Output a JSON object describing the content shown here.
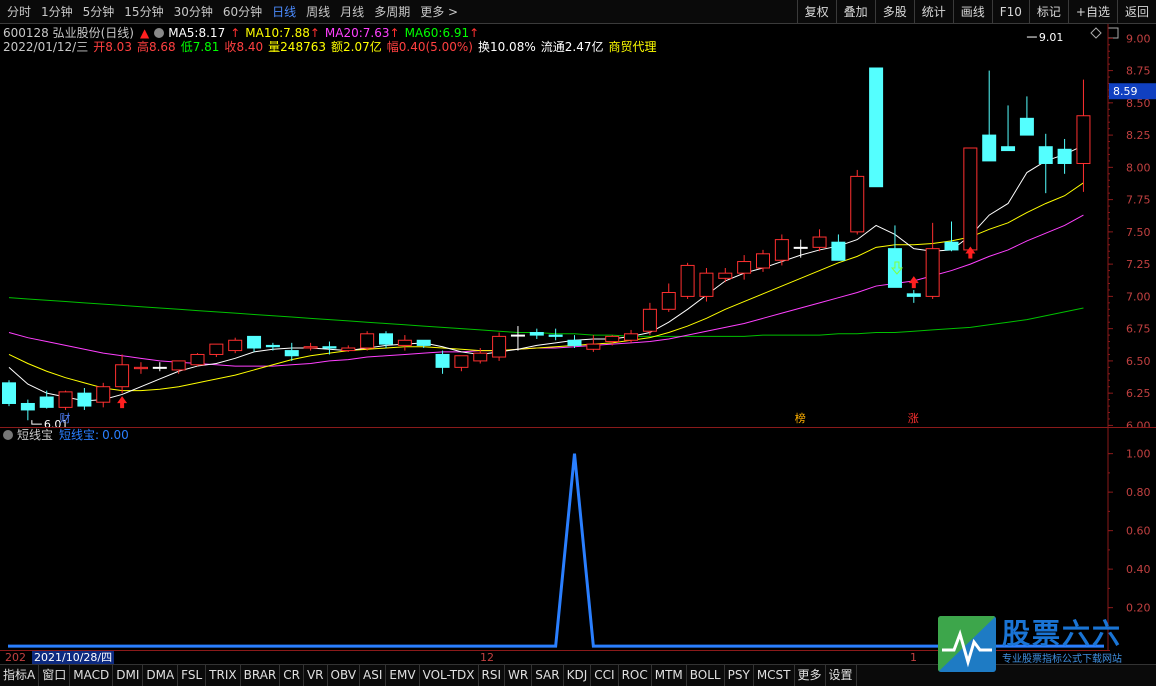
{
  "toolbar": {
    "tabs": [
      {
        "label": "分时"
      },
      {
        "label": "1分钟"
      },
      {
        "label": "5分钟"
      },
      {
        "label": "15分钟"
      },
      {
        "label": "30分钟"
      },
      {
        "label": "60分钟"
      },
      {
        "label": "日线",
        "active": true
      },
      {
        "label": "周线"
      },
      {
        "label": "月线"
      },
      {
        "label": "多周期"
      },
      {
        "label": "更多 >"
      }
    ],
    "right": [
      "复权",
      "叠加",
      "多股",
      "统计",
      "画线",
      "F10",
      "标记",
      "+自选",
      "返回"
    ]
  },
  "quote": {
    "stock": "600128 弘业股份(日线)",
    "ma5_label": "MA5:",
    "ma5": "8.17",
    "ma10_label": "MA10:",
    "ma10": "7.88",
    "ma20_label": "MA20:",
    "ma20": "7.63",
    "ma60_label": "MA60:",
    "ma60": "6.91",
    "date": "2022/01/12/三",
    "open_label": "开",
    "open": "8.03",
    "high_label": "高",
    "high": "8.68",
    "low_label": "低",
    "low": "7.81",
    "close_label": "收",
    "close": "8.40",
    "vol_label": "量",
    "vol": "248763",
    "amt_label": "额",
    "amt": "2.07亿",
    "chg_label": "幅",
    "chg": "0.40(5.00%)",
    "turn_label": "换",
    "turn": "10.08%",
    "float_label": "流通",
    "float": "2.47亿",
    "sector": "商贸代理"
  },
  "chart_data": [
    {
      "type": "candlestick",
      "y_ticks": [
        "9.00",
        "8.75",
        "8.50",
        "8.25",
        "8.00",
        "7.75",
        "7.50",
        "7.25",
        "7.00",
        "6.75",
        "6.50",
        "6.25",
        "6.00"
      ],
      "ylim": [
        5.98,
        9.08
      ],
      "current_price_label": "8.59",
      "high_annotation": "9.01",
      "low_annotation": "6.01",
      "event_markers": [
        "财",
        "榜",
        "涨"
      ],
      "ohlc": [
        [
          6.33,
          6.35,
          6.15,
          6.17
        ],
        [
          6.17,
          6.2,
          6.04,
          6.12
        ],
        [
          6.22,
          6.27,
          6.13,
          6.14
        ],
        [
          6.14,
          6.27,
          6.12,
          6.26
        ],
        [
          6.25,
          6.29,
          6.12,
          6.15
        ],
        [
          6.18,
          6.33,
          6.14,
          6.3
        ],
        [
          6.3,
          6.55,
          6.25,
          6.47
        ],
        [
          6.44,
          6.49,
          6.4,
          6.45
        ],
        [
          6.45,
          6.49,
          6.42,
          6.45
        ],
        [
          6.43,
          6.48,
          6.4,
          6.5
        ],
        [
          6.47,
          6.56,
          6.46,
          6.55
        ],
        [
          6.55,
          6.58,
          6.53,
          6.63
        ],
        [
          6.58,
          6.68,
          6.56,
          6.66
        ],
        [
          6.69,
          6.69,
          6.57,
          6.6
        ],
        [
          6.62,
          6.64,
          6.58,
          6.61
        ],
        [
          6.58,
          6.64,
          6.5,
          6.54
        ],
        [
          6.6,
          6.64,
          6.58,
          6.61
        ],
        [
          6.61,
          6.65,
          6.55,
          6.6
        ],
        [
          6.58,
          6.62,
          6.57,
          6.6
        ],
        [
          6.6,
          6.73,
          6.58,
          6.71
        ],
        [
          6.71,
          6.73,
          6.6,
          6.63
        ],
        [
          6.62,
          6.7,
          6.58,
          6.66
        ],
        [
          6.66,
          6.66,
          6.6,
          6.62
        ],
        [
          6.55,
          6.58,
          6.4,
          6.45
        ],
        [
          6.45,
          6.54,
          6.42,
          6.54
        ],
        [
          6.5,
          6.6,
          6.48,
          6.56
        ],
        [
          6.53,
          6.72,
          6.5,
          6.69
        ],
        [
          6.7,
          6.77,
          6.58,
          6.7
        ],
        [
          6.72,
          6.75,
          6.67,
          6.7
        ],
        [
          6.7,
          6.75,
          6.66,
          6.69
        ],
        [
          6.66,
          6.7,
          6.6,
          6.62
        ],
        [
          6.59,
          6.7,
          6.57,
          6.63
        ],
        [
          6.65,
          6.7,
          6.62,
          6.69
        ],
        [
          6.66,
          6.74,
          6.64,
          6.71
        ],
        [
          6.73,
          6.95,
          6.7,
          6.9
        ],
        [
          6.9,
          7.1,
          6.88,
          7.03
        ],
        [
          7.0,
          7.26,
          6.98,
          7.24
        ],
        [
          7.0,
          7.22,
          6.96,
          7.18
        ],
        [
          7.14,
          7.22,
          7.11,
          7.18
        ],
        [
          7.18,
          7.32,
          7.13,
          7.27
        ],
        [
          7.22,
          7.36,
          7.19,
          7.33
        ],
        [
          7.28,
          7.48,
          7.24,
          7.44
        ],
        [
          7.38,
          7.44,
          7.3,
          7.38
        ],
        [
          7.38,
          7.52,
          7.35,
          7.46
        ],
        [
          7.42,
          7.48,
          7.28,
          7.28
        ],
        [
          7.5,
          7.98,
          7.48,
          7.93
        ],
        [
          8.77,
          8.77,
          7.85,
          7.85
        ],
        [
          7.37,
          7.55,
          7.07,
          7.07
        ],
        [
          7.02,
          7.05,
          6.95,
          7.0
        ],
        [
          7.0,
          7.57,
          6.98,
          7.37
        ],
        [
          7.42,
          7.58,
          7.35,
          7.36
        ],
        [
          7.36,
          8.15,
          7.38,
          8.15
        ],
        [
          8.25,
          8.75,
          8.05,
          8.05
        ],
        [
          8.16,
          8.48,
          8.13,
          8.13
        ],
        [
          8.38,
          8.55,
          8.25,
          8.25
        ],
        [
          8.16,
          8.26,
          7.8,
          8.03
        ],
        [
          8.14,
          8.22,
          7.95,
          8.03
        ],
        [
          8.03,
          8.68,
          7.81,
          8.4
        ]
      ],
      "ma5": [
        6.45,
        6.32,
        6.25,
        6.22,
        6.19,
        6.2,
        6.24,
        6.3,
        6.36,
        6.42,
        6.46,
        6.48,
        6.52,
        6.57,
        6.59,
        6.6,
        6.6,
        6.59,
        6.58,
        6.6,
        6.62,
        6.63,
        6.64,
        6.61,
        6.57,
        6.55,
        6.57,
        6.59,
        6.62,
        6.64,
        6.66,
        6.67,
        6.67,
        6.69,
        6.72,
        6.8,
        6.9,
        7.01,
        7.12,
        7.18,
        7.22,
        7.27,
        7.32,
        7.36,
        7.39,
        7.44,
        7.55,
        7.48,
        7.37,
        7.35,
        7.36,
        7.47,
        7.63,
        7.72,
        7.96,
        8.05,
        8.1,
        8.17
      ],
      "ma10": [
        6.55,
        6.48,
        6.42,
        6.37,
        6.33,
        6.29,
        6.27,
        6.27,
        6.28,
        6.3,
        6.33,
        6.36,
        6.39,
        6.43,
        6.47,
        6.51,
        6.54,
        6.56,
        6.58,
        6.59,
        6.6,
        6.61,
        6.61,
        6.6,
        6.59,
        6.58,
        6.58,
        6.59,
        6.6,
        6.61,
        6.62,
        6.63,
        6.64,
        6.66,
        6.68,
        6.72,
        6.77,
        6.83,
        6.9,
        6.96,
        7.02,
        7.08,
        7.14,
        7.2,
        7.26,
        7.31,
        7.38,
        7.4,
        7.4,
        7.41,
        7.43,
        7.46,
        7.52,
        7.57,
        7.65,
        7.72,
        7.78,
        7.88
      ],
      "ma20": [
        6.72,
        6.68,
        6.65,
        6.62,
        6.59,
        6.56,
        6.54,
        6.52,
        6.5,
        6.49,
        6.48,
        6.47,
        6.46,
        6.46,
        6.46,
        6.47,
        6.48,
        6.5,
        6.51,
        6.53,
        6.54,
        6.55,
        6.56,
        6.57,
        6.57,
        6.58,
        6.58,
        6.59,
        6.6,
        6.6,
        6.61,
        6.62,
        6.63,
        6.64,
        6.65,
        6.67,
        6.7,
        6.73,
        6.76,
        6.79,
        6.83,
        6.87,
        6.91,
        6.95,
        6.99,
        7.03,
        7.08,
        7.1,
        7.12,
        7.16,
        7.2,
        7.25,
        7.31,
        7.36,
        7.43,
        7.49,
        7.55,
        7.63
      ],
      "ma60": [
        6.99,
        6.98,
        6.97,
        6.96,
        6.95,
        6.94,
        6.93,
        6.92,
        6.91,
        6.9,
        6.89,
        6.88,
        6.87,
        6.86,
        6.85,
        6.84,
        6.83,
        6.82,
        6.81,
        6.8,
        6.79,
        6.78,
        6.77,
        6.76,
        6.75,
        6.74,
        6.73,
        6.72,
        6.72,
        6.71,
        6.71,
        6.7,
        6.7,
        6.69,
        6.69,
        6.69,
        6.69,
        6.69,
        6.69,
        6.69,
        6.7,
        6.7,
        6.7,
        6.7,
        6.71,
        6.71,
        6.72,
        6.72,
        6.73,
        6.74,
        6.75,
        6.76,
        6.78,
        6.8,
        6.82,
        6.85,
        6.88,
        6.91
      ]
    },
    {
      "type": "line",
      "y_ticks": [
        "1.00",
        "0.80",
        "0.60",
        "0.40",
        "0.20"
      ],
      "ylim": [
        -0.02,
        1.05
      ],
      "values": [
        0,
        0,
        0,
        0,
        0,
        0,
        0,
        0,
        0,
        0,
        0,
        0,
        0,
        0,
        0,
        0,
        0,
        0,
        0,
        0,
        0,
        0,
        0,
        0,
        0,
        0,
        0,
        0,
        0,
        0,
        1,
        0,
        0,
        0,
        0,
        0,
        0,
        0,
        0,
        0,
        0,
        0,
        0,
        0,
        0,
        0,
        0,
        0,
        0,
        0,
        0,
        0,
        0,
        0,
        0,
        0,
        0,
        0
      ]
    }
  ],
  "indicator": {
    "name": "短线宝",
    "label": "短线宝:",
    "value": "0.00"
  },
  "dates": {
    "start": "202",
    "cursor": "2021/10/28/四",
    "tick_12": "12",
    "tick_1": "1"
  },
  "bottom_tabs": [
    "指标A",
    "窗口",
    "MACD",
    "DMI",
    "DMA",
    "FSL",
    "TRIX",
    "BRAR",
    "CR",
    "VR",
    "OBV",
    "ASI",
    "EMV",
    "VOL-TDX",
    "RSI",
    "WR",
    "SAR",
    "KDJ",
    "CCI",
    "ROC",
    "MTM",
    "BOLL",
    "PSY",
    "MCST",
    "更多",
    "设置"
  ],
  "watermark": {
    "big": "股票六六",
    "small": "专业股票指标公式下载网站"
  },
  "colors": {
    "up": "#ff3030",
    "down": "#54ffff",
    "ma5": "#ffffff",
    "ma10": "#ffff00",
    "ma20": "#ff40ff",
    "ma60": "#00c000",
    "axis": "#8a1a1a",
    "line": "#2a7fff"
  }
}
